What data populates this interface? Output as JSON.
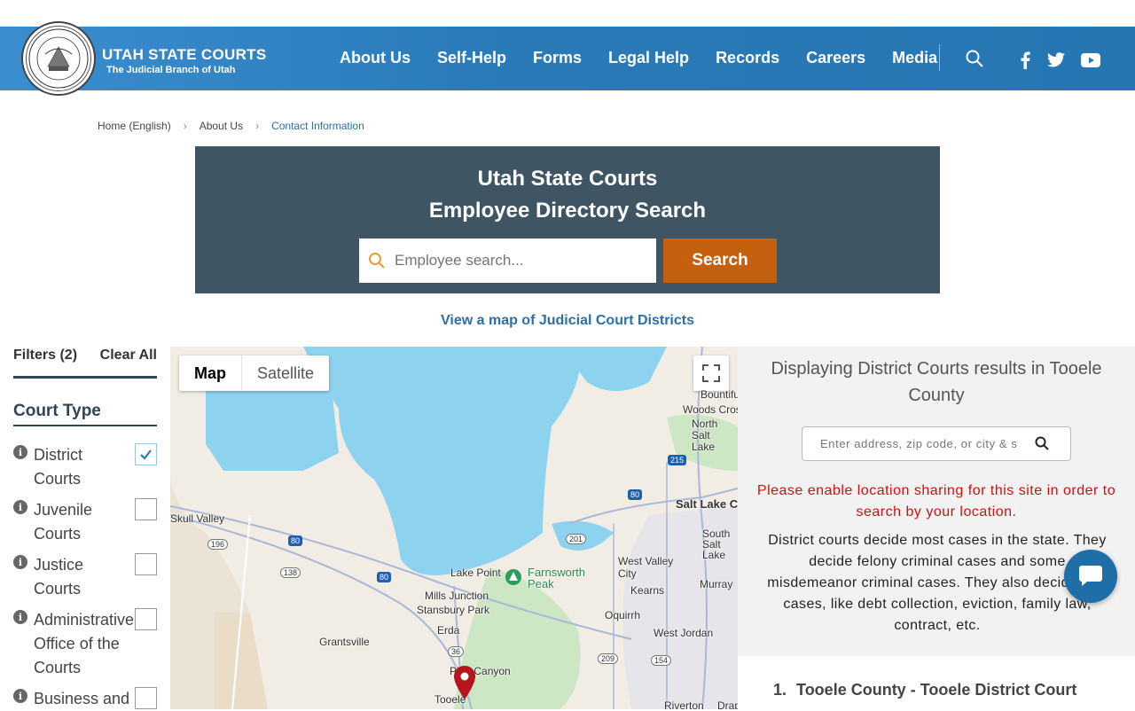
{
  "header": {
    "seal_text": "STATE OF UTAH JUDICIARY",
    "brand_title": "UTAH STATE COURTS",
    "brand_subtitle": "The Judicial Branch of Utah",
    "nav": [
      "About Us",
      "Self-Help",
      "Forms",
      "Legal Help",
      "Records",
      "Careers",
      "Media"
    ]
  },
  "breadcrumb": {
    "items": [
      "Home (English)",
      "About Us",
      "Contact Information"
    ]
  },
  "hero": {
    "title_line1": "Utah State Courts",
    "title_line2": "Employee Directory Search",
    "search_placeholder": "Employee search...",
    "search_button": "Search"
  },
  "map_link": "View a map of Judicial Court Districts",
  "filters": {
    "title": "Filters (2)",
    "clear_all": "Clear All",
    "section_title": "Court Type",
    "items": [
      {
        "label": "District Courts",
        "checked": true
      },
      {
        "label": "Juvenile Courts",
        "checked": false
      },
      {
        "label": "Justice Courts",
        "checked": false
      },
      {
        "label": "Administrative Office of the Courts",
        "checked": false
      },
      {
        "label": "Business and",
        "checked": false
      }
    ]
  },
  "map": {
    "toggle_map": "Map",
    "toggle_satellite": "Satellite",
    "labels": {
      "bountiful": "Bountiful",
      "woods_cross": "Woods Cross",
      "north_salt_lake": "North Salt Lake",
      "salt_lake": "Salt Lake C",
      "south_salt_lake": "South Salt Lake",
      "skull_valley": "Skull Valley",
      "west_valley": "West Valley City",
      "murray": "Murray",
      "kearns": "Kearns",
      "lake_point": "Lake Point",
      "farnsworth": "Farnsworth Peak",
      "mills_junction": "Mills Junction",
      "stansbury": "Stansbury Park",
      "oquirrh": "Oquirrh",
      "grantsville": "Grantsville",
      "erda": "Erda",
      "west_jordan": "West Jordan",
      "pine_canyon": "Pine Canyon",
      "tooele": "Tooele",
      "riverton": "Riverton",
      "draper": "Drap"
    },
    "shields": [
      "215",
      "80",
      "201",
      "196",
      "80",
      "138",
      "80",
      "36",
      "209",
      "154",
      "215"
    ]
  },
  "results": {
    "title": "Displaying District Courts results in Tooele County",
    "address_placeholder": "Enter address, zip code, or city & state",
    "location_warning": "Please enable location sharing for this site in order to search by your location.",
    "description": "District courts decide most cases in the state. They decide felony criminal cases and some misdemeanor criminal cases. They also decide civil cases, like debt collection, eviction, family law, contract, etc.",
    "first_result_number": "1.",
    "first_result": "Tooele County - Tooele District Court"
  },
  "colors": {
    "header_blue": "#2a7ab8",
    "hero_bg": "#3f5564",
    "search_button": "#c5600e",
    "warning": "#d01010",
    "link": "#2a6fa8"
  }
}
